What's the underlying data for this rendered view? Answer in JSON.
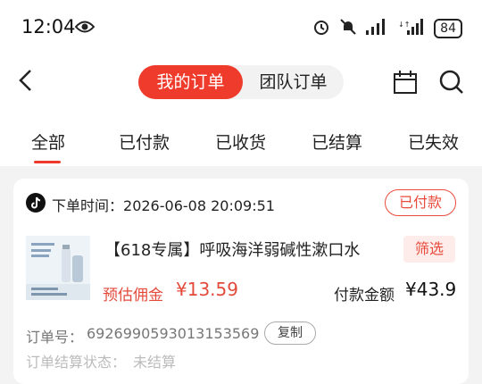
{
  "status_bar": {
    "time": "12:04",
    "battery": "84"
  },
  "header": {
    "active_tab": "我的订单",
    "other_tab": "团队订单"
  },
  "tabs": [
    "全部",
    "已付款",
    "已收货",
    "已结算",
    "已失效"
  ],
  "order": {
    "time_label": "下单时间：",
    "time": "2026-06-08 20:09:51",
    "status_badge": "已付款",
    "product_title": "【618专属】呼吸海洋弱碱性漱口水",
    "filter_label": "筛选",
    "commission_label": "预估佣金",
    "commission_value": "¥13.59",
    "payment_label": "付款金额",
    "payment_value": "¥43.9",
    "order_no_label": "订单号：",
    "order_no": "6926990593013153569",
    "copy_label": "复制",
    "settle_label": "订单结算状态：",
    "settle_value": "未结算"
  },
  "colors": {
    "accent": "#ef3b2c"
  }
}
